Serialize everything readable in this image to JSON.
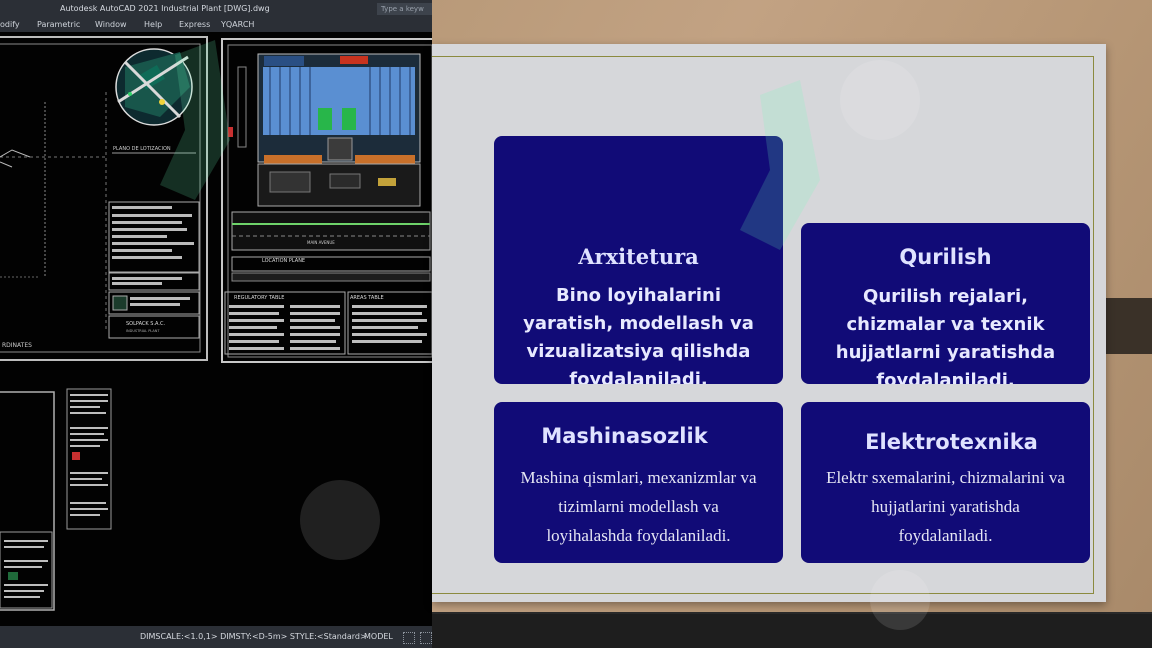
{
  "autocad": {
    "title": "Autodesk AutoCAD 2021   Industrial Plant [DWG].dwg",
    "search_placeholder": "Type a keyw",
    "menu": [
      "odify",
      "Parametric",
      "Window",
      "Help",
      "Express",
      "YQARCH"
    ],
    "status_dimscale": "DIMSCALE:<1.0,1> DIMSTY:<D-5m> STYLE:<Standard>",
    "status_model": "MODEL",
    "drawing_labels": {
      "plano": "PLANO DE LOTIZACION",
      "location": "LOCATION PLANE",
      "regulatory": "REGULATORY TABLE",
      "areas": "AREAS TABLE",
      "company": "SOLPACK S.A.C.",
      "plant": "INDUSTRIAL PLANT",
      "coordinates": "RDINATES",
      "main": "MAIN AVENUE"
    }
  },
  "cards": [
    {
      "title": "Arxitetura",
      "desc": "Bino loyihalarini yaratish, modellash va vizualizatsiya qilishda foydalaniladi."
    },
    {
      "title": "Qurilish",
      "desc": "Qurilish rejalari, chizmalar va texnik hujjatlarni yaratishda foydalaniladi."
    },
    {
      "title": "Mashinasozlik",
      "desc": "Mashina qismlari, mexanizmlar va tizimlarni modellash va loyihalashda foydalaniladi."
    },
    {
      "title": "Elektrotexnika",
      "desc": "Elektr sxemalarini, chizmalarini va hujjatlarini yaratishda foydalaniladi."
    }
  ],
  "colors": {
    "card_bg": "#110b77",
    "slide_bg": "#d6d7da",
    "cad_bg": "#020202"
  }
}
